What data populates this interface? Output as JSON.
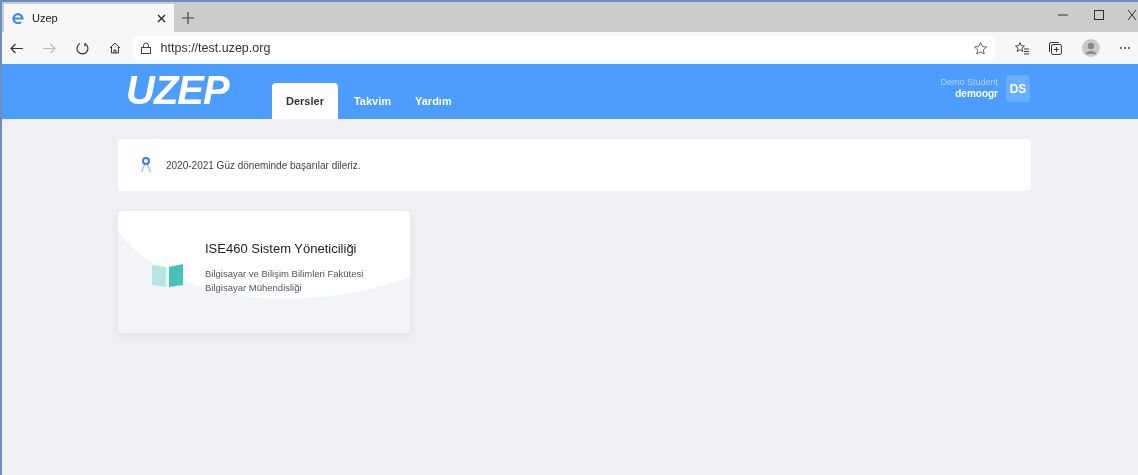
{
  "browser": {
    "tab_title": "Uzep",
    "url": "https://test.uzep.org"
  },
  "header": {
    "logo": "UZEP",
    "nav": [
      {
        "label": "Dersler",
        "selected": true
      },
      {
        "label": "Takvim",
        "selected": false
      },
      {
        "label": "Yardım",
        "selected": false
      }
    ],
    "user": {
      "name": "Demo Student",
      "username": "demoogr",
      "initials": "DS"
    }
  },
  "notice": {
    "text": "2020-2021 Güz döneminde başarılar dileriz."
  },
  "courses": [
    {
      "title": "ISE460 Sistem Yöneticiliği",
      "faculty": "Bilgisayar ve Bilişim Bilimleri Fakütesi",
      "department": "Bilgisayar Mühendisliği"
    }
  ]
}
